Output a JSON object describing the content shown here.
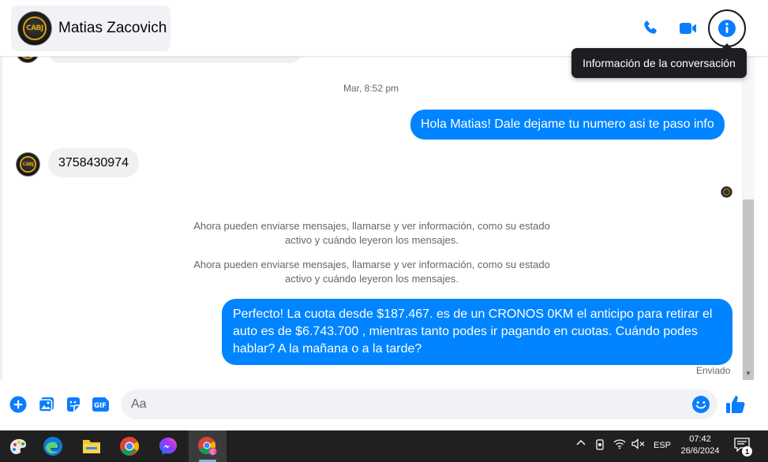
{
  "conversation": {
    "contact_name": "Matias Zacovich",
    "tooltip": "Información de la conversación",
    "timestamp": "Mar, 8:52 pm",
    "avatar_text": "CABJ",
    "messages": {
      "out_1": "Hola Matias! Dale dejame tu numero asi te paso info",
      "in_1": "3758430974",
      "system_1": "Ahora pueden enviarse mensajes, llamarse y ver información, como su estado activo y cuándo leyeron los mensajes.",
      "system_2": "Ahora pueden enviarse mensajes, llamarse y ver información, como su estado activo y cuándo leyeron los mensajes.",
      "out_2": "Perfecto! La cuota desde $187.467. es de un CRONOS 0KM el anticipo para retirar el auto es de $6.743.700 , mientras tanto podes ir pagando en cuotas. Cuándo podes hablar? A la mañana o a la tarde?",
      "sent_status": "Enviado"
    }
  },
  "composer": {
    "placeholder": "Aa"
  },
  "taskbar": {
    "apps": [
      "paint-icon",
      "edge-icon",
      "file-explorer-icon",
      "chrome-icon",
      "messenger-icon",
      "chrome-profile-icon"
    ],
    "language": "ESP",
    "time": "07:42",
    "date": "26/6/2024",
    "notification_count": "1"
  },
  "colors": {
    "accent": "#0084ff",
    "icon_blue": "#0a7cff",
    "incoming_bubble": "#f0f0f0",
    "taskbar": "#202020"
  }
}
